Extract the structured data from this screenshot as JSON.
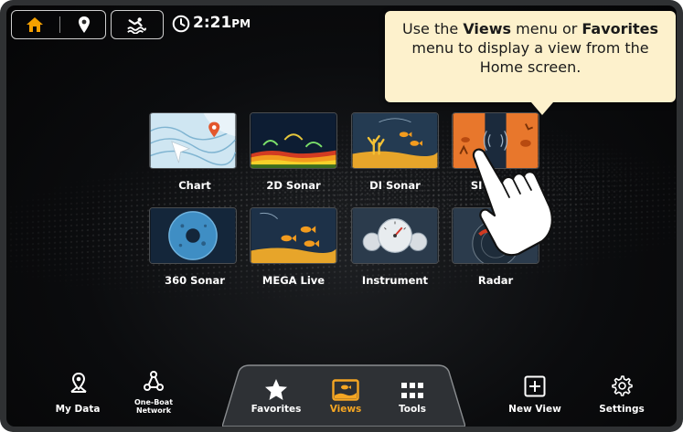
{
  "status_bar": {
    "time": "2:21",
    "ampm": "PM"
  },
  "tooltip": {
    "line1_prefix": "Use the ",
    "line1_views": "Views",
    "line1_mid": " menu or ",
    "line1_favorites": "Favorites",
    "line2": "menu to display a view from the",
    "line3": "Home screen."
  },
  "views": [
    {
      "label": "Chart"
    },
    {
      "label": "2D Sonar"
    },
    {
      "label": "DI Sonar"
    },
    {
      "label": "SI Sonar"
    },
    {
      "label": "360 Sonar"
    },
    {
      "label": "MEGA Live"
    },
    {
      "label": "Instrument"
    },
    {
      "label": "Radar"
    }
  ],
  "bottom_nav": {
    "my_data": "My Data",
    "one_boat_1": "One-Boat",
    "one_boat_2": "Network",
    "favorites": "Favorites",
    "views": "Views",
    "tools": "Tools",
    "new_view": "New View",
    "settings": "Settings"
  },
  "colors": {
    "accent_orange": "#f5a623",
    "home_icon": "#f5a000",
    "tooltip_bg": "#fdf1cc",
    "screen_bg": "#0b0c0e"
  }
}
